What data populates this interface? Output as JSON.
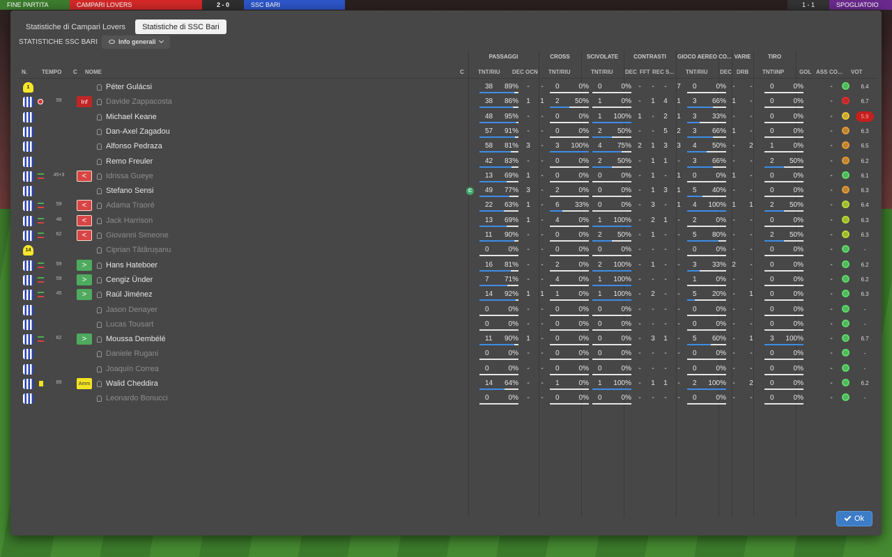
{
  "topbar": {
    "end_match": "FINE PARTITA",
    "home_team": "CAMPARI LOVERS",
    "score": "2 - 0",
    "away_team": "SSC BARI",
    "score_right": "1 - 1",
    "dressing_room": "SPOGLIATOIO"
  },
  "tabs": [
    {
      "label": "Statistiche di Campari Lovers",
      "active": false
    },
    {
      "label": "Statistiche di SSC Bari",
      "active": true
    }
  ],
  "subheader": {
    "title": "STATISTICHE SSC BARI",
    "view_label": "Info generali"
  },
  "groups": [
    "PASSAGGI",
    "CROSS",
    "SCIVOLATE",
    "CONTRASTI",
    "GIOCO AEREO",
    "CO...",
    "VARIE",
    "TIRO"
  ],
  "columns": {
    "n": "N.",
    "time": "TEMPO",
    "c": "C",
    "name": "NOME",
    "c2": "C",
    "pass_tnt": "TNT/RIU",
    "pass_dec": "DEC",
    "pass_ocn": "OCN",
    "cross_tnt": "TNT/RIU",
    "tack_tnt": "TNT/RIU",
    "cont_dec": "DEC",
    "cont_fft": "FFT",
    "cont_rec": "REC",
    "cont_s": "S...",
    "air_tnt": "TNT/RIU",
    "co_dec": "DEC",
    "drb": "DRB",
    "shot_tnt": "TNT\\INP",
    "gol": "GOL",
    "ass": "ASS",
    "co": "CO...",
    "vot": "VOT"
  },
  "players": [
    {
      "kit": "gk",
      "num": "1",
      "event": "",
      "min": "",
      "badge": "",
      "name": "Péter Gulácsi",
      "dim": false,
      "captain": false,
      "pass": [
        "38",
        "89%"
      ],
      "pass_fill": 89,
      "dec": "-",
      "ocn": "-",
      "cross": [
        "0",
        "0%"
      ],
      "cross_fill": 0,
      "tack": [
        "0",
        "0%"
      ],
      "tack_fill": 0,
      "cdec": "-",
      "fft": "-",
      "rec": "-",
      "s": "7",
      "air": [
        "0",
        "0%"
      ],
      "air_fill": 0,
      "codec": "-",
      "drb": "-",
      "shot": [
        "0",
        "0%"
      ],
      "shot_fill": 0,
      "gol": "",
      "ass": "-",
      "mood": "green",
      "vot": "6.4"
    },
    {
      "kit": "out",
      "num": "",
      "event": "inj",
      "min": "59",
      "badge": "inj",
      "badge_text": "Inf",
      "name": "Davide Zappacosta",
      "dim": true,
      "captain": false,
      "pass": [
        "38",
        "86%"
      ],
      "pass_fill": 86,
      "dec": "1",
      "ocn": "1",
      "cross": [
        "2",
        "50%"
      ],
      "cross_fill": 50,
      "tack": [
        "1",
        "0%"
      ],
      "tack_fill": 0,
      "cdec": "-",
      "fft": "1",
      "rec": "4",
      "s": "1",
      "air": [
        "3",
        "66%"
      ],
      "air_fill": 66,
      "codec": "1",
      "drb": "-",
      "shot": [
        "0",
        "0%"
      ],
      "shot_fill": 0,
      "gol": "",
      "ass": "-",
      "mood": "red",
      "vot": "6.7"
    },
    {
      "kit": "out",
      "num": "",
      "event": "",
      "min": "",
      "badge": "",
      "name": "Michael Keane",
      "dim": false,
      "captain": false,
      "pass": [
        "48",
        "95%"
      ],
      "pass_fill": 95,
      "dec": "-",
      "ocn": "-",
      "cross": [
        "0",
        "0%"
      ],
      "cross_fill": 0,
      "tack": [
        "1",
        "100%"
      ],
      "tack_fill": 100,
      "cdec": "1",
      "fft": "-",
      "rec": "2",
      "s": "1",
      "air": [
        "3",
        "33%"
      ],
      "air_fill": 33,
      "codec": "-",
      "drb": "-",
      "shot": [
        "0",
        "0%"
      ],
      "shot_fill": 0,
      "gol": "",
      "ass": "-",
      "mood": "yellow",
      "vot": "5.9",
      "vot_bad": true
    },
    {
      "kit": "out",
      "num": "",
      "event": "",
      "min": "",
      "badge": "",
      "name": "Dan-Axel Zagadou",
      "dim": false,
      "captain": false,
      "pass": [
        "57",
        "91%"
      ],
      "pass_fill": 91,
      "dec": "-",
      "ocn": "-",
      "cross": [
        "0",
        "0%"
      ],
      "cross_fill": 0,
      "tack": [
        "2",
        "50%"
      ],
      "tack_fill": 50,
      "cdec": "-",
      "fft": "-",
      "rec": "5",
      "s": "2",
      "air": [
        "3",
        "66%"
      ],
      "air_fill": 66,
      "codec": "1",
      "drb": "-",
      "shot": [
        "0",
        "0%"
      ],
      "shot_fill": 0,
      "gol": "",
      "ass": "-",
      "mood": "orange",
      "vot": "6.3"
    },
    {
      "kit": "out",
      "num": "",
      "event": "",
      "min": "",
      "badge": "",
      "name": "Alfonso Pedraza",
      "dim": false,
      "captain": false,
      "pass": [
        "58",
        "81%"
      ],
      "pass_fill": 81,
      "dec": "3",
      "ocn": "-",
      "cross": [
        "3",
        "100%"
      ],
      "cross_fill": 100,
      "tack": [
        "4",
        "75%"
      ],
      "tack_fill": 75,
      "cdec": "2",
      "fft": "1",
      "rec": "3",
      "s": "3",
      "air": [
        "4",
        "50%"
      ],
      "air_fill": 50,
      "codec": "-",
      "drb": "2",
      "shot": [
        "1",
        "0%"
      ],
      "shot_fill": 0,
      "gol": "",
      "ass": "-",
      "mood": "orange",
      "vot": "6.5"
    },
    {
      "kit": "out",
      "num": "",
      "event": "",
      "min": "",
      "badge": "",
      "name": "Remo Freuler",
      "dim": false,
      "captain": false,
      "pass": [
        "42",
        "83%"
      ],
      "pass_fill": 83,
      "dec": "-",
      "ocn": "-",
      "cross": [
        "0",
        "0%"
      ],
      "cross_fill": 0,
      "tack": [
        "2",
        "50%"
      ],
      "tack_fill": 50,
      "cdec": "-",
      "fft": "1",
      "rec": "1",
      "s": "-",
      "air": [
        "3",
        "66%"
      ],
      "air_fill": 66,
      "codec": "-",
      "drb": "-",
      "shot": [
        "2",
        "50%"
      ],
      "shot_fill": 50,
      "gol": "",
      "ass": "-",
      "mood": "orange",
      "vot": "6.2"
    },
    {
      "kit": "out",
      "num": "",
      "event": "sub",
      "min": "45+3",
      "badge": "out",
      "badge_text": "<",
      "name": "Idrissa Gueye",
      "dim": true,
      "captain": false,
      "pass": [
        "13",
        "69%"
      ],
      "pass_fill": 69,
      "dec": "1",
      "ocn": "-",
      "cross": [
        "0",
        "0%"
      ],
      "cross_fill": 0,
      "tack": [
        "0",
        "0%"
      ],
      "tack_fill": 0,
      "cdec": "-",
      "fft": "1",
      "rec": "-",
      "s": "1",
      "air": [
        "0",
        "0%"
      ],
      "air_fill": 0,
      "codec": "1",
      "drb": "-",
      "shot": [
        "0",
        "0%"
      ],
      "shot_fill": 0,
      "gol": "",
      "ass": "-",
      "mood": "green",
      "vot": "6.1"
    },
    {
      "kit": "out",
      "num": "",
      "event": "",
      "min": "",
      "badge": "",
      "name": "Stefano Sensi",
      "dim": false,
      "captain": true,
      "pass": [
        "49",
        "77%"
      ],
      "pass_fill": 77,
      "dec": "3",
      "ocn": "-",
      "cross": [
        "2",
        "0%"
      ],
      "cross_fill": 0,
      "tack": [
        "0",
        "0%"
      ],
      "tack_fill": 0,
      "cdec": "-",
      "fft": "1",
      "rec": "3",
      "s": "1",
      "air": [
        "5",
        "40%"
      ],
      "air_fill": 40,
      "codec": "-",
      "drb": "-",
      "shot": [
        "0",
        "0%"
      ],
      "shot_fill": 0,
      "gol": "",
      "ass": "-",
      "mood": "orange",
      "vot": "6.3"
    },
    {
      "kit": "out",
      "num": "",
      "event": "sub",
      "min": "59",
      "badge": "out",
      "badge_text": "<",
      "name": "Adama Traoré",
      "dim": true,
      "captain": false,
      "pass": [
        "22",
        "63%"
      ],
      "pass_fill": 63,
      "dec": "1",
      "ocn": "-",
      "cross": [
        "6",
        "33%"
      ],
      "cross_fill": 33,
      "tack": [
        "0",
        "0%"
      ],
      "tack_fill": 0,
      "cdec": "-",
      "fft": "3",
      "rec": "-",
      "s": "1",
      "air": [
        "4",
        "100%"
      ],
      "air_fill": 100,
      "codec": "1",
      "drb": "1",
      "shot": [
        "2",
        "50%"
      ],
      "shot_fill": 50,
      "gol": "",
      "ass": "-",
      "mood": "lime",
      "vot": "6.4"
    },
    {
      "kit": "out",
      "num": "",
      "event": "sub",
      "min": "48",
      "badge": "out",
      "badge_text": "<",
      "name": "Jack Harrison",
      "dim": true,
      "captain": false,
      "pass": [
        "13",
        "69%"
      ],
      "pass_fill": 69,
      "dec": "1",
      "ocn": "-",
      "cross": [
        "4",
        "0%"
      ],
      "cross_fill": 0,
      "tack": [
        "1",
        "100%"
      ],
      "tack_fill": 100,
      "cdec": "-",
      "fft": "2",
      "rec": "1",
      "s": "-",
      "air": [
        "2",
        "0%"
      ],
      "air_fill": 0,
      "codec": "-",
      "drb": "-",
      "shot": [
        "0",
        "0%"
      ],
      "shot_fill": 0,
      "gol": "",
      "ass": "-",
      "mood": "lime",
      "vot": "6.3"
    },
    {
      "kit": "out",
      "num": "",
      "event": "sub",
      "min": "62",
      "badge": "out",
      "badge_text": "<",
      "name": "Giovanni Simeone",
      "dim": true,
      "captain": false,
      "pass": [
        "11",
        "90%"
      ],
      "pass_fill": 90,
      "dec": "-",
      "ocn": "-",
      "cross": [
        "0",
        "0%"
      ],
      "cross_fill": 0,
      "tack": [
        "2",
        "50%"
      ],
      "tack_fill": 50,
      "cdec": "-",
      "fft": "1",
      "rec": "-",
      "s": "-",
      "air": [
        "5",
        "80%"
      ],
      "air_fill": 80,
      "codec": "-",
      "drb": "-",
      "shot": [
        "2",
        "50%"
      ],
      "shot_fill": 50,
      "gol": "",
      "ass": "-",
      "mood": "lime",
      "vot": "6.3"
    },
    {
      "kit": "gk",
      "num": "14",
      "event": "",
      "min": "",
      "badge": "",
      "name": "Ciprian Tătărușanu",
      "dim": true,
      "captain": false,
      "pass": [
        "0",
        "0%"
      ],
      "pass_fill": 0,
      "dec": "-",
      "ocn": "-",
      "cross": [
        "0",
        "0%"
      ],
      "cross_fill": 0,
      "tack": [
        "0",
        "0%"
      ],
      "tack_fill": 0,
      "cdec": "-",
      "fft": "-",
      "rec": "-",
      "s": "-",
      "air": [
        "0",
        "0%"
      ],
      "air_fill": 0,
      "codec": "-",
      "drb": "-",
      "shot": [
        "0",
        "0%"
      ],
      "shot_fill": 0,
      "gol": "",
      "ass": "-",
      "mood": "green",
      "vot": "-"
    },
    {
      "kit": "out",
      "num": "",
      "event": "sub",
      "min": "59",
      "badge": "in",
      "badge_text": ">",
      "name": "Hans Hateboer",
      "dim": false,
      "captain": false,
      "pass": [
        "16",
        "81%"
      ],
      "pass_fill": 81,
      "dec": "-",
      "ocn": "-",
      "cross": [
        "2",
        "0%"
      ],
      "cross_fill": 0,
      "tack": [
        "2",
        "100%"
      ],
      "tack_fill": 100,
      "cdec": "-",
      "fft": "1",
      "rec": "-",
      "s": "-",
      "air": [
        "3",
        "33%"
      ],
      "air_fill": 33,
      "codec": "2",
      "drb": "-",
      "shot": [
        "0",
        "0%"
      ],
      "shot_fill": 0,
      "gol": "",
      "ass": "-",
      "mood": "green",
      "vot": "6.2"
    },
    {
      "kit": "out",
      "num": "",
      "event": "sub",
      "min": "59",
      "badge": "in",
      "badge_text": ">",
      "name": "Cengiz Ünder",
      "dim": false,
      "captain": false,
      "pass": [
        "7",
        "71%"
      ],
      "pass_fill": 71,
      "dec": "-",
      "ocn": "-",
      "cross": [
        "4",
        "0%"
      ],
      "cross_fill": 0,
      "tack": [
        "1",
        "100%"
      ],
      "tack_fill": 100,
      "cdec": "-",
      "fft": "-",
      "rec": "-",
      "s": "-",
      "air": [
        "1",
        "0%"
      ],
      "air_fill": 0,
      "codec": "-",
      "drb": "-",
      "shot": [
        "0",
        "0%"
      ],
      "shot_fill": 0,
      "gol": "",
      "ass": "-",
      "mood": "green",
      "vot": "6.2"
    },
    {
      "kit": "out",
      "num": "",
      "event": "sub",
      "min": "45",
      "badge": "in",
      "badge_text": ">",
      "name": "Raúl Jiménez",
      "dim": false,
      "captain": false,
      "pass": [
        "14",
        "92%"
      ],
      "pass_fill": 92,
      "dec": "1",
      "ocn": "1",
      "cross": [
        "1",
        "0%"
      ],
      "cross_fill": 0,
      "tack": [
        "1",
        "100%"
      ],
      "tack_fill": 100,
      "cdec": "-",
      "fft": "2",
      "rec": "-",
      "s": "-",
      "air": [
        "5",
        "20%"
      ],
      "air_fill": 20,
      "codec": "-",
      "drb": "1",
      "shot": [
        "0",
        "0%"
      ],
      "shot_fill": 0,
      "gol": "",
      "ass": "-",
      "mood": "green",
      "vot": "6.3"
    },
    {
      "kit": "out",
      "num": "",
      "event": "",
      "min": "",
      "badge": "",
      "name": "Jason Denayer",
      "dim": true,
      "captain": false,
      "pass": [
        "0",
        "0%"
      ],
      "pass_fill": 0,
      "dec": "-",
      "ocn": "-",
      "cross": [
        "0",
        "0%"
      ],
      "cross_fill": 0,
      "tack": [
        "0",
        "0%"
      ],
      "tack_fill": 0,
      "cdec": "-",
      "fft": "-",
      "rec": "-",
      "s": "-",
      "air": [
        "0",
        "0%"
      ],
      "air_fill": 0,
      "codec": "-",
      "drb": "-",
      "shot": [
        "0",
        "0%"
      ],
      "shot_fill": 0,
      "gol": "",
      "ass": "-",
      "mood": "green",
      "vot": "-"
    },
    {
      "kit": "out",
      "num": "",
      "event": "",
      "min": "",
      "badge": "",
      "name": "Lucas Tousart",
      "dim": true,
      "captain": false,
      "pass": [
        "0",
        "0%"
      ],
      "pass_fill": 0,
      "dec": "-",
      "ocn": "-",
      "cross": [
        "0",
        "0%"
      ],
      "cross_fill": 0,
      "tack": [
        "0",
        "0%"
      ],
      "tack_fill": 0,
      "cdec": "-",
      "fft": "-",
      "rec": "-",
      "s": "-",
      "air": [
        "0",
        "0%"
      ],
      "air_fill": 0,
      "codec": "-",
      "drb": "-",
      "shot": [
        "0",
        "0%"
      ],
      "shot_fill": 0,
      "gol": "",
      "ass": "-",
      "mood": "green",
      "vot": "-"
    },
    {
      "kit": "out",
      "num": "",
      "event": "sub",
      "min": "62",
      "badge": "in",
      "badge_text": ">",
      "name": "Moussa Dembélé",
      "dim": false,
      "captain": false,
      "pass": [
        "11",
        "90%"
      ],
      "pass_fill": 90,
      "dec": "1",
      "ocn": "-",
      "cross": [
        "0",
        "0%"
      ],
      "cross_fill": 0,
      "tack": [
        "0",
        "0%"
      ],
      "tack_fill": 0,
      "cdec": "-",
      "fft": "3",
      "rec": "1",
      "s": "-",
      "air": [
        "5",
        "60%"
      ],
      "air_fill": 60,
      "codec": "-",
      "drb": "1",
      "shot": [
        "3",
        "100%"
      ],
      "shot_fill": 100,
      "gol": "",
      "ass": "-",
      "mood": "green",
      "vot": "6.7"
    },
    {
      "kit": "out",
      "num": "",
      "event": "",
      "min": "",
      "badge": "",
      "name": "Daniele Rugani",
      "dim": true,
      "captain": false,
      "pass": [
        "0",
        "0%"
      ],
      "pass_fill": 0,
      "dec": "-",
      "ocn": "-",
      "cross": [
        "0",
        "0%"
      ],
      "cross_fill": 0,
      "tack": [
        "0",
        "0%"
      ],
      "tack_fill": 0,
      "cdec": "-",
      "fft": "-",
      "rec": "-",
      "s": "-",
      "air": [
        "0",
        "0%"
      ],
      "air_fill": 0,
      "codec": "-",
      "drb": "-",
      "shot": [
        "0",
        "0%"
      ],
      "shot_fill": 0,
      "gol": "",
      "ass": "-",
      "mood": "green",
      "vot": "-"
    },
    {
      "kit": "out",
      "num": "",
      "event": "",
      "min": "",
      "badge": "",
      "name": "Joaquín Correa",
      "dim": true,
      "captain": false,
      "pass": [
        "0",
        "0%"
      ],
      "pass_fill": 0,
      "dec": "-",
      "ocn": "-",
      "cross": [
        "0",
        "0%"
      ],
      "cross_fill": 0,
      "tack": [
        "0",
        "0%"
      ],
      "tack_fill": 0,
      "cdec": "-",
      "fft": "-",
      "rec": "-",
      "s": "-",
      "air": [
        "0",
        "0%"
      ],
      "air_fill": 0,
      "codec": "-",
      "drb": "-",
      "shot": [
        "0",
        "0%"
      ],
      "shot_fill": 0,
      "gol": "",
      "ass": "-",
      "mood": "green",
      "vot": "-"
    },
    {
      "kit": "out",
      "num": "",
      "event": "yel",
      "min": "89",
      "badge": "yel",
      "badge_text": "Amm",
      "name": "Walid Cheddira",
      "dim": false,
      "captain": false,
      "pass": [
        "14",
        "64%"
      ],
      "pass_fill": 64,
      "dec": "-",
      "ocn": "-",
      "cross": [
        "1",
        "0%"
      ],
      "cross_fill": 0,
      "tack": [
        "1",
        "100%"
      ],
      "tack_fill": 100,
      "cdec": "-",
      "fft": "1",
      "rec": "1",
      "s": "-",
      "air": [
        "2",
        "100%"
      ],
      "air_fill": 100,
      "codec": "-",
      "drb": "2",
      "shot": [
        "0",
        "0%"
      ],
      "shot_fill": 0,
      "gol": "",
      "ass": "-",
      "mood": "green",
      "vot": "6.2"
    },
    {
      "kit": "out",
      "num": "",
      "event": "",
      "min": "",
      "badge": "",
      "name": "Leonardo Bonucci",
      "dim": true,
      "captain": false,
      "pass": [
        "0",
        "0%"
      ],
      "pass_fill": 0,
      "dec": "-",
      "ocn": "-",
      "cross": [
        "0",
        "0%"
      ],
      "cross_fill": 0,
      "tack": [
        "0",
        "0%"
      ],
      "tack_fill": 0,
      "cdec": "-",
      "fft": "-",
      "rec": "-",
      "s": "-",
      "air": [
        "0",
        "0%"
      ],
      "air_fill": 0,
      "codec": "-",
      "drb": "-",
      "shot": [
        "0",
        "0%"
      ],
      "shot_fill": 0,
      "gol": "",
      "ass": "-",
      "mood": "green",
      "vot": "-"
    }
  ],
  "captain_mark": "C",
  "ok_label": "Ok",
  "colors": {
    "bar_fill": "#3e8ee8",
    "mood_green": "#5fd86b",
    "mood_lime": "#b8d83a",
    "mood_yellow": "#e8c43a",
    "mood_orange": "#e09a3a",
    "mood_red": "#e03030"
  }
}
